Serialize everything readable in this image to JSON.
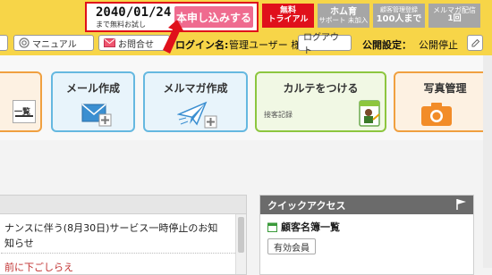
{
  "header": {
    "trial_date": "2040/01/24",
    "trial_sub": "まで無料お試し",
    "apply_label": "本申し込みする",
    "buttons": [
      {
        "line1": "無料",
        "line2": "トライアル"
      },
      {
        "line1": "ホム育",
        "line2": "サポート 未加入"
      },
      {
        "line1": "顧客管理登録",
        "line2": "100人まで"
      },
      {
        "line1": "メルマガ配信",
        "line2": "1回"
      }
    ]
  },
  "nav": {
    "manual": "マニュアル",
    "contact": "お問合せ",
    "login_label": "ログイン名:",
    "login_user": "管理ユーザー 様",
    "logout": "ログアウト",
    "public_label": "公開設定：",
    "public_value": "公開停止"
  },
  "cards": [
    {
      "title": "",
      "sub": ""
    },
    {
      "title": "メール作成",
      "sub": ""
    },
    {
      "title": "メルマガ作成",
      "sub": ""
    },
    {
      "title": "カルテをつける",
      "sub": "接客記録"
    },
    {
      "title": "写真管理",
      "sub": ""
    }
  ],
  "card1_icon_text": "一覧",
  "news": {
    "line1": "ナンスに伴う(8月30日)サービス一時停止のお知",
    "line2": "知らせ",
    "line3": "前に下ごしらえ"
  },
  "quick_access": {
    "title": "クイックアクセス",
    "link_label": "顧客名簿一覧",
    "tag_label": "有効会員"
  },
  "colors": {
    "header_yellow": "#f7d548",
    "accent_red": "#e0101b",
    "apply_pink": "#ef6b8f",
    "gray_button": "#a6a6a6"
  }
}
